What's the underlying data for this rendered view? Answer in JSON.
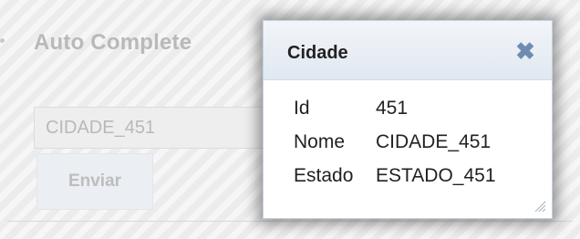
{
  "page": {
    "section_title": "Auto Complete",
    "input_value": "CIDADE_451",
    "submit_label": "Enviar"
  },
  "dialog": {
    "title": "Cidade",
    "close_icon": "close-icon",
    "fields": [
      {
        "label": "Id",
        "value": "451"
      },
      {
        "label": "Nome",
        "value": "CIDADE_451"
      },
      {
        "label": "Estado",
        "value": "ESTADO_451"
      }
    ]
  },
  "colors": {
    "dialog_header_top": "#f2f5f9",
    "dialog_header_bottom": "#e0e8f0",
    "close_icon": "#6f8cb0",
    "background": "#ececec"
  }
}
